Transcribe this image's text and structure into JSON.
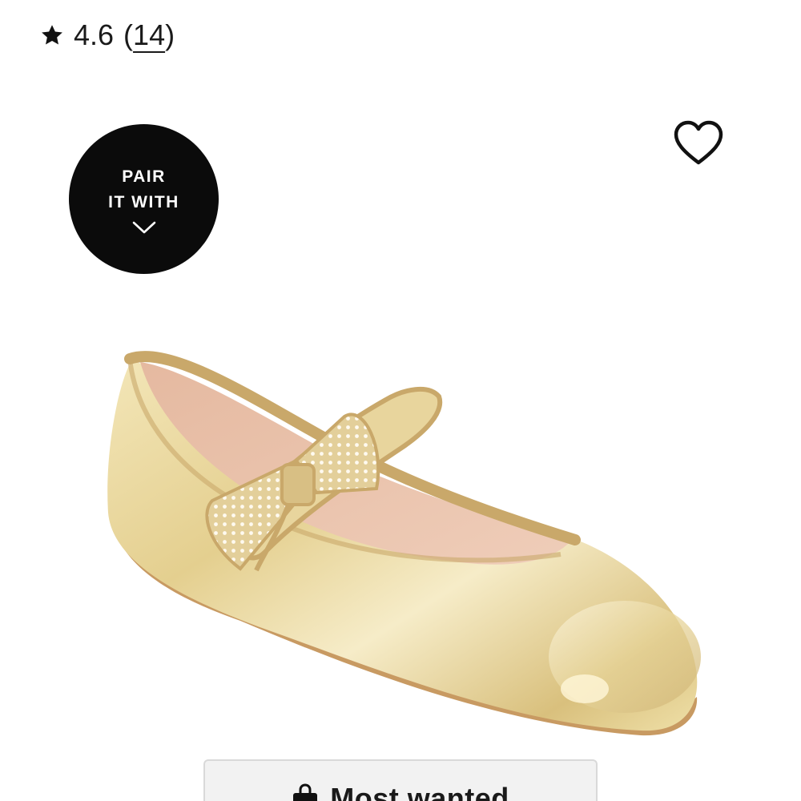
{
  "rating": {
    "icon": "star-icon",
    "score": "4.6",
    "open_paren": "(",
    "count": "14",
    "close_paren": ")"
  },
  "pair_badge": {
    "line1": "PAIR",
    "line2": "IT WITH",
    "icon": "chevron-down-icon"
  },
  "favorite": {
    "icon": "heart-outline-icon"
  },
  "product_image": {
    "subject": "gold metallic mary jane ballet flat with jeweled bow",
    "colors": {
      "metal": "#e6d49c",
      "trim": "#c9a86a",
      "lining": "#e9c3ad",
      "sole": "#c89a62"
    }
  },
  "badge": {
    "icon": "shopping-bag-icon",
    "label": "Most wanted"
  }
}
